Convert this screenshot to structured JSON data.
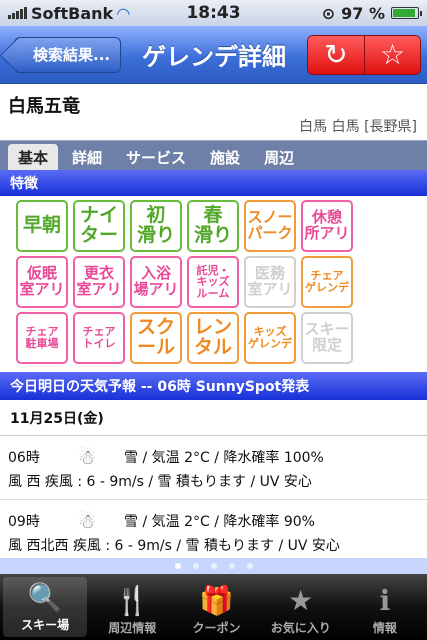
{
  "status": {
    "carrier": "SoftBank",
    "time": "18:43",
    "battery": "97 %"
  },
  "nav": {
    "back": "検索結果...",
    "title": "ゲレンデ詳細",
    "refresh_icon": "refresh-icon",
    "star_icon": "star-icon"
  },
  "resort": {
    "name": "白馬五竜",
    "location": "白馬 白馬 [長野県]"
  },
  "tabs": [
    "基本",
    "詳細",
    "サービス",
    "施設",
    "周辺"
  ],
  "features_title": "特徴",
  "features": [
    {
      "text": "早朝",
      "color": "g",
      "size": "big"
    },
    {
      "text": "ナイ\nター",
      "color": "g",
      "size": "big"
    },
    {
      "text": "初\n滑り",
      "color": "g",
      "size": "big"
    },
    {
      "text": "春\n滑り",
      "color": "g",
      "size": "big"
    },
    {
      "text": "スノー\nパーク",
      "color": "o",
      "size": "mid"
    },
    {
      "text": "休憩\n所アリ",
      "color": "p",
      "size": "mid"
    },
    {
      "text": "仮眠\n室アリ",
      "color": "p",
      "size": "mid"
    },
    {
      "text": "更衣\n室アリ",
      "color": "p",
      "size": "mid"
    },
    {
      "text": "入浴\n場アリ",
      "color": "p",
      "size": "mid"
    },
    {
      "text": "託児・\nキッズ\nルーム",
      "color": "p",
      "size": "sm"
    },
    {
      "text": "医務\n室アリ",
      "color": "x",
      "size": "mid"
    },
    {
      "text": "チェア\nゲレンデ",
      "color": "o",
      "size": "sm"
    },
    {
      "text": "チェア\n駐車場",
      "color": "p",
      "size": "sm"
    },
    {
      "text": "チェア\nトイレ",
      "color": "p",
      "size": "sm"
    },
    {
      "text": "スク\nール",
      "color": "o",
      "size": "big"
    },
    {
      "text": "レン\nタル",
      "color": "o",
      "size": "big"
    },
    {
      "text": "キッズ\nゲレンデ",
      "color": "o",
      "size": "sm"
    },
    {
      "text": "スキー\n限定",
      "color": "x",
      "size": "mid"
    }
  ],
  "weather": {
    "title": "今日明日の天気予報 -- 06時 SunnySpot発表",
    "date": "11月25日(金)",
    "rows": [
      {
        "hour": "06時",
        "cond": "雪 / 気温 2°C / 降水確率 100%",
        "wind": "風 西 疾風 : 6 - 9m/s / 雪 積もります / UV 安心"
      },
      {
        "hour": "09時",
        "cond": "雪 / 気温 2°C / 降水確率 90%",
        "wind": "風 西北西 疾風 : 6 - 9m/s / 雪 積もります / UV 安心"
      }
    ]
  },
  "tabbar": [
    {
      "label": "スキー場",
      "icon": "search-icon",
      "glyph": "🔍"
    },
    {
      "label": "周辺情報",
      "icon": "fork-knife-icon",
      "glyph": "🍴"
    },
    {
      "label": "クーポン",
      "icon": "gift-icon",
      "glyph": "🎁"
    },
    {
      "label": "お気に入り",
      "icon": "star-icon",
      "glyph": "★"
    },
    {
      "label": "情報",
      "icon": "info-icon",
      "glyph": "ℹ"
    }
  ]
}
